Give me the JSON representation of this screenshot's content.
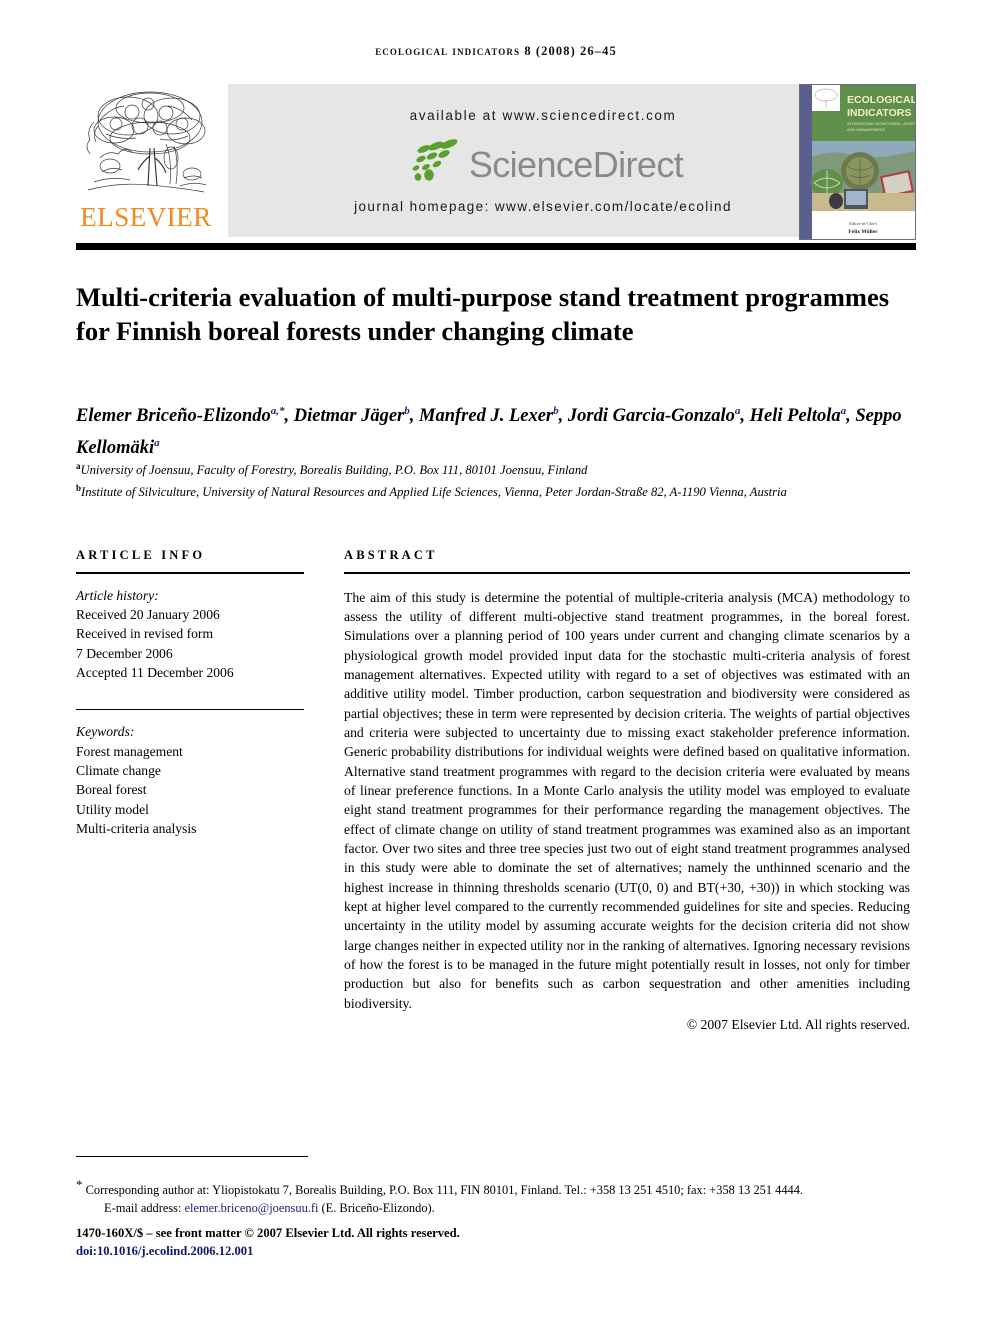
{
  "running_head": "Ecological Indicators 8 (2008) 26–45",
  "header": {
    "publisher_name": "ELSEVIER",
    "publisher_logo_alt": "elsevier-tree-logo",
    "sciencedirect": {
      "available_at": "available at www.sciencedirect.com",
      "brand": "ScienceDirect",
      "journal_homepage": "journal homepage: www.elsevier.com/locate/ecolind"
    },
    "cover": {
      "title_line1": "ECOLOGICAL",
      "title_line2": "INDICATORS",
      "subtitle": "INTEGRATING MONITORING, ASSESSMENT AND MANAGEMENT",
      "editor_label": "Editor-in-Chief",
      "editor_name": "Felix Müller"
    }
  },
  "article": {
    "title": "Multi-criteria evaluation of multi-purpose stand treatment programmes for Finnish boreal forests under changing climate",
    "authors_html": "Elemer Briceño-Elizondo<sup>a,*</sup>, Dietmar Jäger<sup>b</sup>, Manfred J. Lexer<sup>b</sup>, Jordi Garcia-Gonzalo<sup>a</sup>, Heli Peltola<sup>a</sup>, Seppo Kellomäki<sup>a</sup>",
    "affiliation_a": "University of Joensuu, Faculty of Forestry, Borealis Building, P.O. Box 111, 80101 Joensuu, Finland",
    "affiliation_b": "Institute of Silviculture, University of Natural Resources and Applied Life Sciences, Vienna, Peter Jordan-Straße 82, A-1190 Vienna, Austria"
  },
  "article_info": {
    "heading": "ARTICLE INFO",
    "history_label": "Article history:",
    "received": "Received 20 January 2006",
    "revised_label": "Received in revised form",
    "revised_date": "7 December 2006",
    "accepted": "Accepted 11 December 2006",
    "keywords_label": "Keywords:",
    "keywords": [
      "Forest management",
      "Climate change",
      "Boreal forest",
      "Utility model",
      "Multi-criteria analysis"
    ]
  },
  "abstract": {
    "heading": "ABSTRACT",
    "body": "The aim of this study is determine the potential of multiple-criteria analysis (MCA) methodology to assess the utility of different multi-objective stand treatment programmes, in the boreal forest. Simulations over a planning period of 100 years under current and changing climate scenarios by a physiological growth model provided input data for the stochastic multi-criteria analysis of forest management alternatives. Expected utility with regard to a set of objectives was estimated with an additive utility model. Timber production, carbon sequestration and biodiversity were considered as partial objectives; these in term were represented by decision criteria. The weights of partial objectives and criteria were subjected to uncertainty due to missing exact stakeholder preference information. Generic probability distributions for individual weights were defined based on qualitative information. Alternative stand treatment programmes with regard to the decision criteria were evaluated by means of linear preference functions. In a Monte Carlo analysis the utility model was employed to evaluate eight stand treatment programmes for their performance regarding the management objectives. The effect of climate change on utility of stand treatment programmes was examined also as an important factor. Over two sites and three tree species just two out of eight stand treatment programmes analysed in this study were able to dominate the set of alternatives; namely the unthinned scenario and the highest increase in thinning thresholds scenario (UT(0, 0) and BT(+30, +30)) in which stocking was kept at higher level compared to the currently recommended guidelines for site and species. Reducing uncertainty in the utility model by assuming accurate weights for the decision criteria did not show large changes neither in expected utility nor in the ranking of alternatives. Ignoring necessary revisions of how the forest is to be managed in the future might potentially result in losses, not only for timber production but also for benefits such as carbon sequestration and other amenities including biodiversity.",
    "copyright": "© 2007 Elsevier Ltd. All rights reserved."
  },
  "footer": {
    "corresponding_author": "Corresponding author at: Yliopistokatu 7, Borealis Building, P.O. Box 111, FIN 80101, Finland. Tel.: +358 13 251 4510; fax: +358 13 251 4444.",
    "email_label": "E-mail address:",
    "email": "elemer.briceno@joensuu.fi",
    "email_suffix": "(E. Briceño-Elizondo).",
    "issn_line": "1470-160X/$ – see front matter © 2007 Elsevier Ltd. All rights reserved.",
    "doi_prefix": "doi:",
    "doi": "10.1016/j.ecolind.2006.12.001"
  },
  "colors": {
    "elsevier_orange": "#F08A1E",
    "sciencedirect_green": "#5aa02c",
    "sciencedirect_gray": "#8a8a8a",
    "band_background": "#e6e6e6",
    "link_blue": "#1b1f6e",
    "superscript_blue": "#1d2a6b"
  }
}
